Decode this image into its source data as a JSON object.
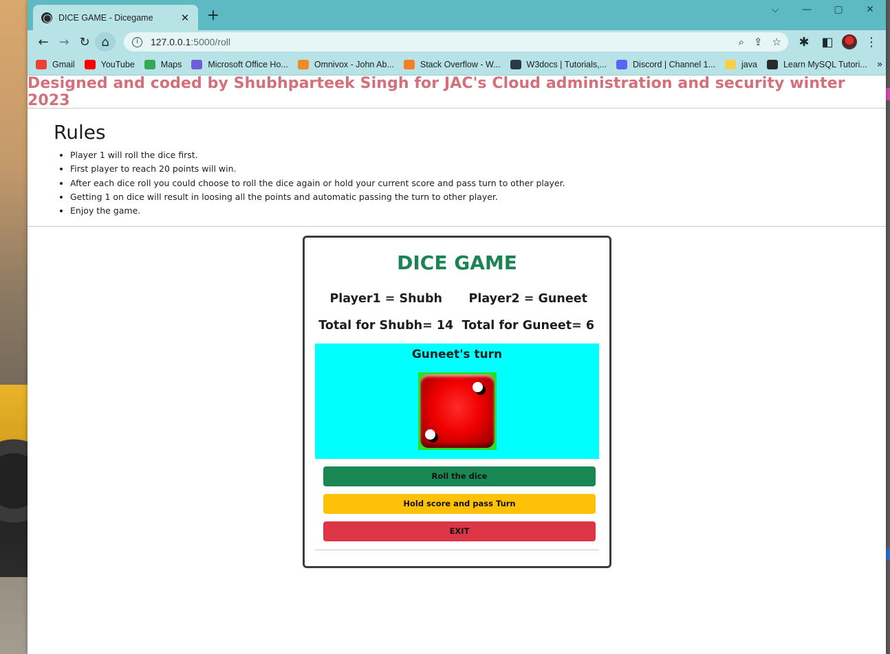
{
  "browser": {
    "tab_title": "DICE GAME - Dicegame",
    "new_tab": "+",
    "url_host": "127.0.0.1",
    "url_path": ":5000/roll",
    "window_controls": [
      "⌵",
      "—",
      "▢",
      "✕"
    ],
    "bookmarks": [
      {
        "label": "Gmail",
        "icon": "gmail-icon",
        "color": "#ea4335"
      },
      {
        "label": "YouTube",
        "icon": "youtube-icon",
        "color": "#ff0000"
      },
      {
        "label": "Maps",
        "icon": "maps-icon",
        "color": "#34a853"
      },
      {
        "label": "Microsoft Office Ho...",
        "icon": "office-icon",
        "color": "#6f5cd6"
      },
      {
        "label": "Omnivox - John Ab...",
        "icon": "omnivox-icon",
        "color": "#f08a24"
      },
      {
        "label": "Stack Overflow - W...",
        "icon": "stackoverflow-icon",
        "color": "#f48024"
      },
      {
        "label": "W3docs | Tutorials,...",
        "icon": "w3docs-icon",
        "color": "#2b3a4a"
      },
      {
        "label": "Discord | Channel 1...",
        "icon": "discord-icon",
        "color": "#5865f2"
      },
      {
        "label": "java",
        "icon": "folder-icon",
        "color": "#f6d04d"
      },
      {
        "label": "Learn MySQL Tutori...",
        "icon": "globe-icon",
        "color": "#2a2a2a"
      }
    ],
    "bookmarks_more": "»"
  },
  "page": {
    "credit": "Designed and coded by Shubhparteek Singh for JAC's Cloud administration and security winter 2023",
    "rules_title": "Rules",
    "rules": [
      "Player 1 will roll the dice first.",
      "First player to reach 20 points will win.",
      "After each dice roll you could choose to roll the dice again or hold your current score and pass turn to other player.",
      "Getting 1 on dice will result in loosing all the points and automatic passing the turn to other player.",
      "Enjoy the game."
    ]
  },
  "game": {
    "title": "DICE GAME",
    "player1_label": "Player1 = Shubh",
    "player2_label": "Player2 = Guneet",
    "player1_total": "Total for Shubh= 14",
    "player2_total": "Total for Guneet= 6",
    "turn_text": "Guneet's turn",
    "die_value": 2,
    "buttons": {
      "roll": "Roll the dice",
      "hold": "Hold score and pass Turn",
      "exit": "EXIT"
    },
    "colors": {
      "title": "#1a8455",
      "credit": "#d4707c",
      "turn_bg": "#00ffff",
      "roll": "#198754",
      "hold": "#ffc107",
      "exit": "#dc3545"
    }
  }
}
